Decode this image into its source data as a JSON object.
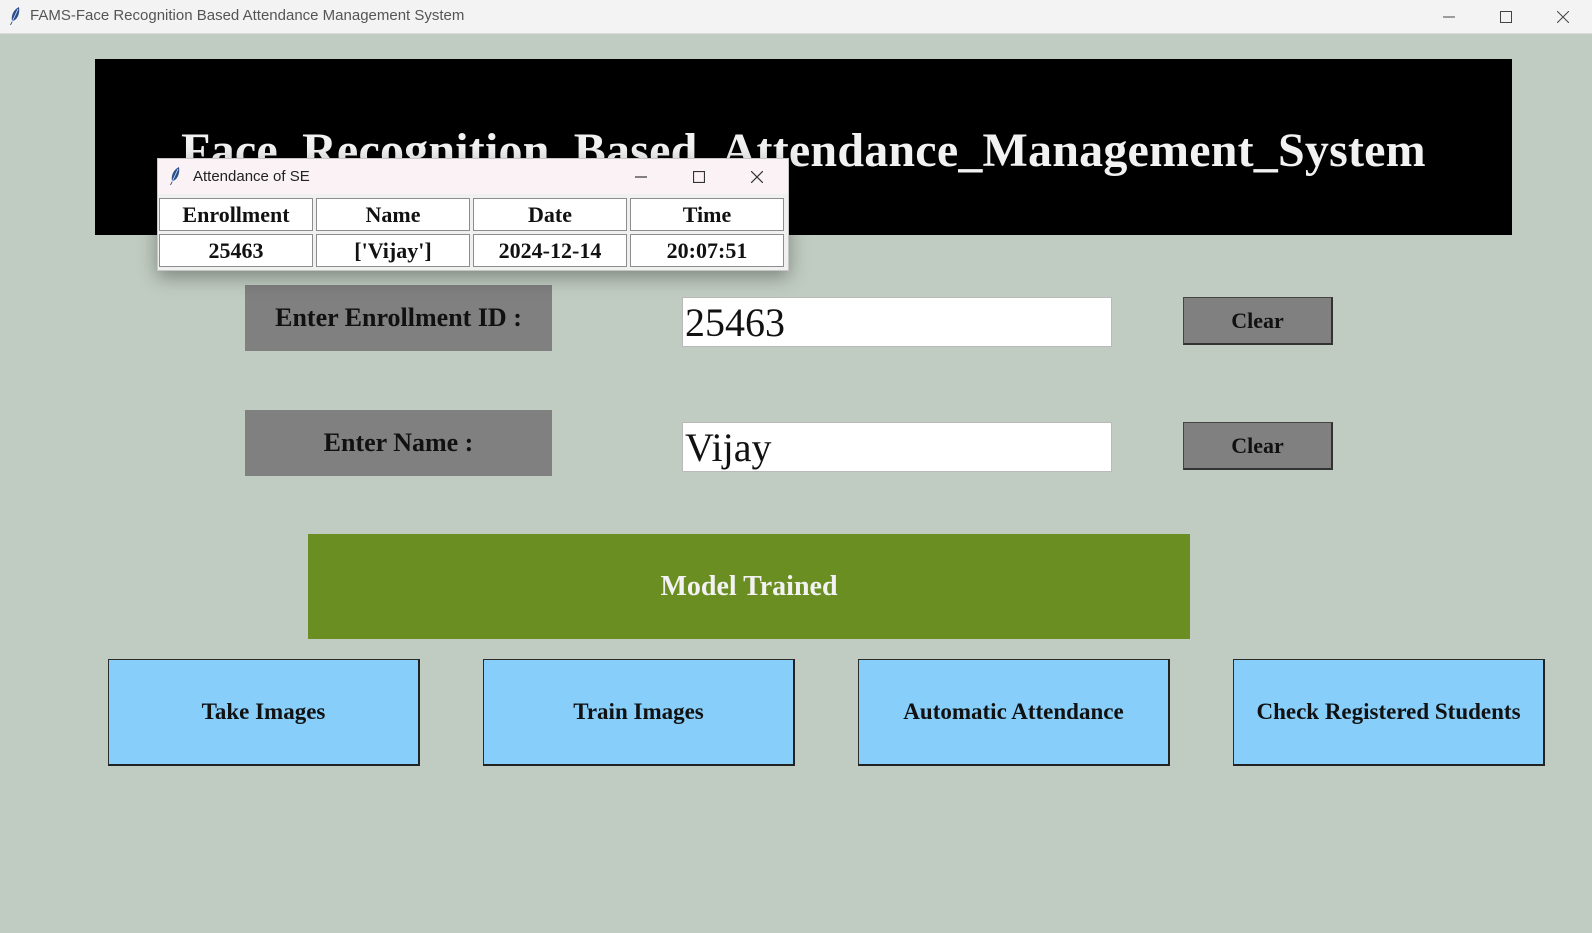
{
  "main_window": {
    "title": "FAMS-Face Recognition Based Attendance Management System"
  },
  "banner": {
    "text": "Face_Recognition_Based_Attendance_Management_System"
  },
  "form": {
    "enrollment_label": "Enter Enrollment ID :",
    "enrollment_value": "25463",
    "name_label": "Enter Name :",
    "name_value": "Vijay",
    "clear_label": "Clear"
  },
  "status": {
    "text": "Model Trained",
    "color": "#6b8e23"
  },
  "actions": [
    {
      "label": "Take Images"
    },
    {
      "label": "Train Images"
    },
    {
      "label": "Automatic Attendance"
    },
    {
      "label": "Check Registered Students"
    }
  ],
  "popup": {
    "title": "Attendance of SE",
    "headers": [
      "Enrollment",
      "Name",
      "Date",
      "Time"
    ],
    "rows": [
      [
        "25463",
        "['Vijay']",
        "2024-12-14",
        "20:07:51"
      ]
    ]
  },
  "colors": {
    "background": "#c0ccc1",
    "banner": "#000000",
    "label_box": "#808080",
    "action_button": "#87cefa"
  },
  "icons": {
    "app": "feather-icon",
    "minimize": "minimize-icon",
    "maximize": "maximize-icon",
    "close": "close-icon"
  }
}
